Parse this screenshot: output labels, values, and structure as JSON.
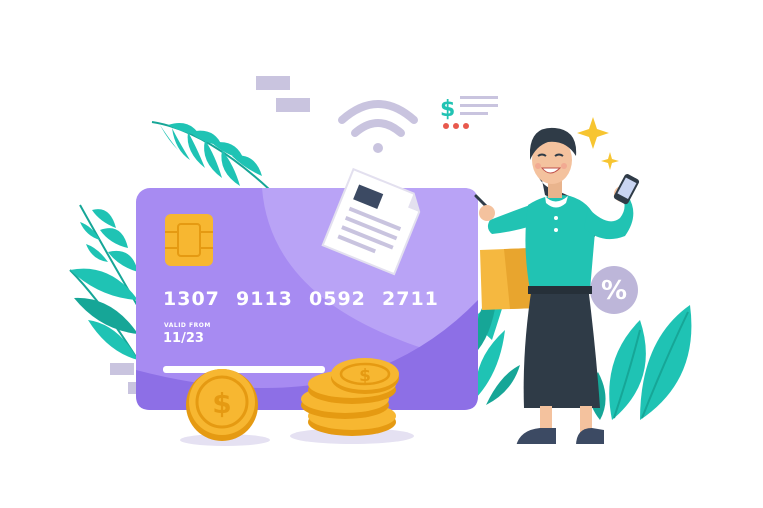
{
  "card": {
    "number_groups": [
      "1307",
      "9113",
      "0592",
      "2711"
    ],
    "valid_from_label": "VALID FROM",
    "expiry": "11/23"
  },
  "symbols": {
    "dollar": "$",
    "percent": "%"
  },
  "colors": {
    "card_purple": "#a78bf2",
    "card_light": "#b9a3f6",
    "card_dark": "#8d6fe6",
    "chip": "#f7b731",
    "coin": "#f7b731",
    "coin_dark": "#e59a12",
    "leaf_teal": "#1fc3b4",
    "leaf_dark": "#16a697",
    "sweater": "#21c3b3",
    "skirt": "#2f3b47",
    "bag": "#f5b840",
    "sparkle": "#f7c531",
    "percent_badge": "#bdb6d9",
    "accent_red": "#e8594d",
    "gray": "#c9c4df"
  },
  "icons": [
    "wifi-icon",
    "receipt-icon",
    "chip-icon",
    "dollar-coin-icon",
    "percent-badge-icon",
    "sparkle-icon",
    "phone-icon",
    "shopping-bag-icon",
    "price-tag-icon"
  ]
}
